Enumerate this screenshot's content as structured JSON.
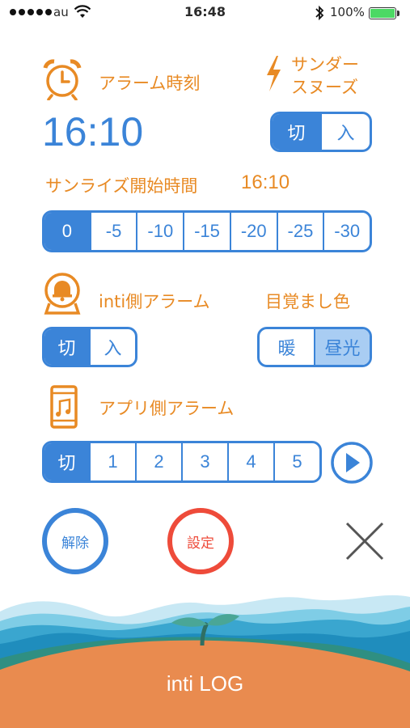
{
  "status_bar": {
    "carrier": "au",
    "time": "16:48",
    "battery": "100%"
  },
  "alarm": {
    "label": "アラーム時刻",
    "time": "16:10"
  },
  "thunder_snooze": {
    "label_line1": "サンダー",
    "label_line2": "スヌーズ",
    "options": [
      "切",
      "入"
    ],
    "selected": "切"
  },
  "sunrise": {
    "label": "サンライズ開始時間",
    "time": "16:10",
    "options": [
      "0",
      "-5",
      "-10",
      "-15",
      "-20",
      "-25",
      "-30"
    ],
    "selected": "0"
  },
  "inti_alarm": {
    "label": "inti側アラーム",
    "options": [
      "切",
      "入"
    ],
    "selected": "切"
  },
  "wake_color": {
    "label": "目覚まし色",
    "options": [
      "暖",
      "昼光"
    ],
    "selected": "昼光"
  },
  "app_alarm": {
    "label": "アプリ側アラーム",
    "options": [
      "切",
      "1",
      "2",
      "3",
      "4",
      "5"
    ],
    "selected": "切"
  },
  "actions": {
    "cancel_label": "解除",
    "set_label": "設定"
  },
  "footer": {
    "brand": "inti LOG"
  },
  "colors": {
    "accent_blue": "#3b84d8",
    "accent_orange": "#e88a24",
    "set_red": "#ee4b3a"
  },
  "icons": [
    "alarm-clock-icon",
    "lightning-icon",
    "bell-lamp-icon",
    "phone-music-icon",
    "play-icon",
    "close-icon",
    "wifi-icon",
    "bluetooth-icon",
    "battery-icon"
  ]
}
